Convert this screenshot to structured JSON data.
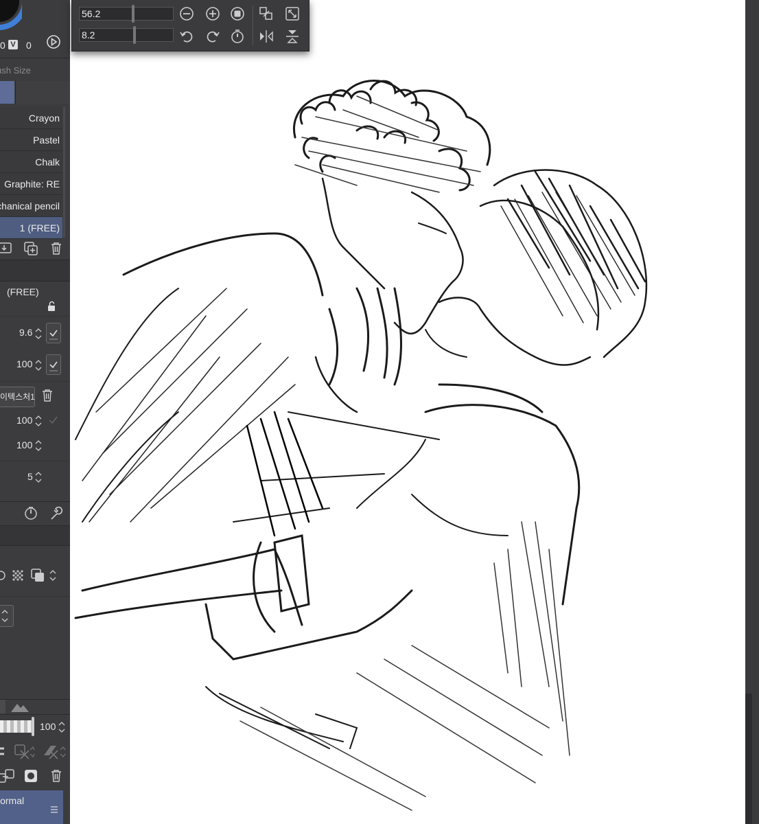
{
  "color_panel": {
    "value_a": "0",
    "v_label": "V",
    "value_b": "0"
  },
  "brush_size_tab": "Brush Size",
  "brush_list": [
    {
      "label": "Crayon",
      "active": false
    },
    {
      "label": "Pastel",
      "active": false
    },
    {
      "label": "Chalk",
      "active": false
    },
    {
      "label": "Graphite: RE",
      "active": false
    },
    {
      "label": "Mechanical pencil",
      "active": false
    },
    {
      "label": "1 (FREE)",
      "active": true
    }
  ],
  "tool_property": {
    "preset_name": "(FREE)",
    "brush_size": "9.6",
    "opacity": "100",
    "texture_name": "이텍스처1",
    "texture_density": "100",
    "texture_strength": "100",
    "stabilization": "5"
  },
  "layer_panel": {
    "opacity": "100",
    "blend_mode": "Normal"
  },
  "navigator": {
    "zoom": "56.2",
    "rotation": "8.2"
  },
  "icons": [
    "play-icon",
    "new-brush-icon",
    "duplicate-icon",
    "trash-icon",
    "lock-icon",
    "dial-icon",
    "wrench-icon",
    "mirror-icon",
    "flip-vertical-icon",
    "rotate-left-icon",
    "rotate-right-icon",
    "zoom-in-icon",
    "zoom-out-icon",
    "fit-icon",
    "reset-icon"
  ],
  "colors": {
    "panel": "#3c3c3e",
    "active_item": "#4e5d80",
    "canvas": "#ffffff"
  }
}
